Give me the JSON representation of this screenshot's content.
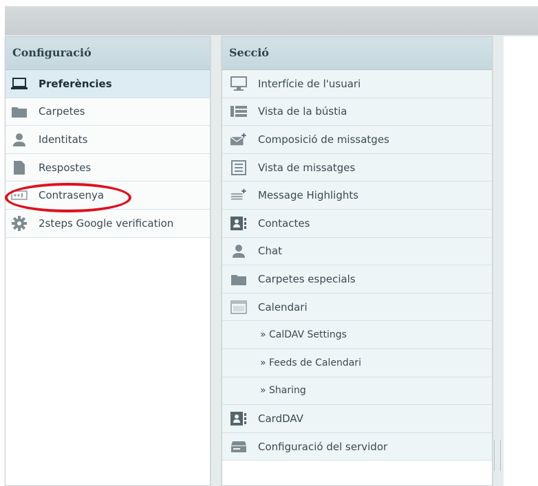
{
  "left_panel": {
    "title": "Configuració",
    "items": [
      {
        "label": "Preferències",
        "icon": "laptop-icon"
      },
      {
        "label": "Carpetes",
        "icon": "folder-icon"
      },
      {
        "label": "Identitats",
        "icon": "user-icon"
      },
      {
        "label": "Respostes",
        "icon": "document-icon"
      },
      {
        "label": "Contrasenya",
        "icon": "password-icon"
      },
      {
        "label": "2steps Google verification",
        "icon": "gear-icon"
      }
    ]
  },
  "middle_panel": {
    "title": "Secció",
    "items": [
      {
        "label": "Interfície de l'usuari",
        "icon": "monitor-icon"
      },
      {
        "label": "Vista de la bústia",
        "icon": "mailbox-view-icon"
      },
      {
        "label": "Composició de missatges",
        "icon": "compose-icon"
      },
      {
        "label": "Vista de missatges",
        "icon": "message-view-icon"
      },
      {
        "label": "Message Highlights",
        "icon": "highlight-icon"
      },
      {
        "label": "Contactes",
        "icon": "contacts-icon"
      },
      {
        "label": "Chat",
        "icon": "user-icon"
      },
      {
        "label": "Carpetes especials",
        "icon": "folder-icon"
      },
      {
        "label": "Calendari",
        "icon": "calendar-icon"
      },
      {
        "label": "» CalDAV Settings",
        "icon": ""
      },
      {
        "label": "» Feeds de Calendari",
        "icon": ""
      },
      {
        "label": "» Sharing",
        "icon": ""
      },
      {
        "label": "CardDAV",
        "icon": "contacts-icon"
      },
      {
        "label": "Configuració del servidor",
        "icon": "server-icon"
      }
    ]
  },
  "colors": {
    "header_bg": "#c5d8de",
    "selected_bg": "#dcecf2",
    "highlight_ellipse": "#e0101d",
    "icon_gray": "#7e8b90"
  }
}
